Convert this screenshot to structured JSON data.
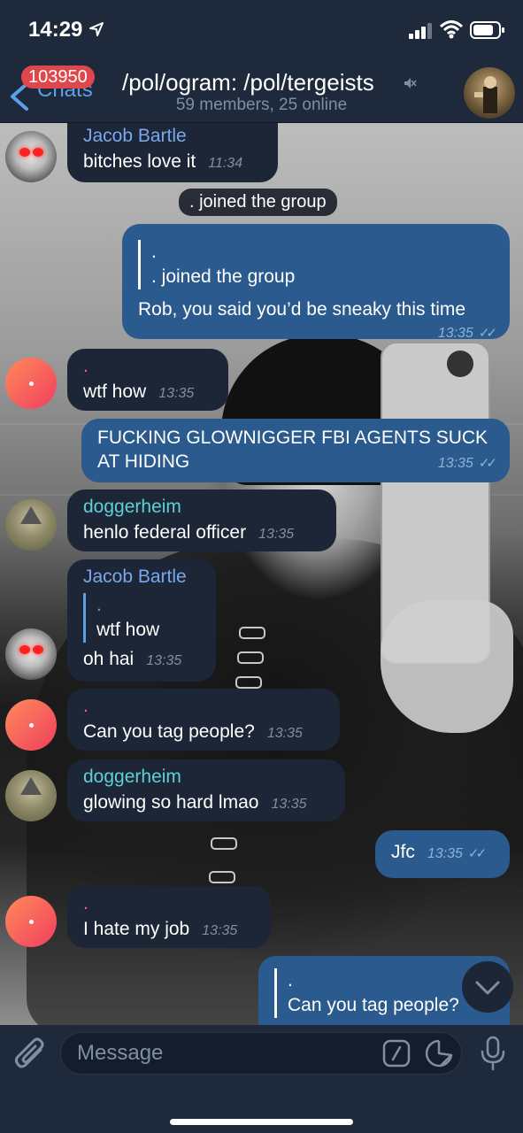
{
  "status_bar": {
    "time": "14:29"
  },
  "header": {
    "back_label": "Chats",
    "unread_count": "103950",
    "title": "/pol/ogram: /pol/tergeists",
    "subtitle": "59 members, 25 online"
  },
  "messages": {
    "m1": {
      "sender": "Jacob Bartle",
      "text": "bitches love it",
      "time": "11:34"
    },
    "s1": {
      "text": ". joined the group"
    },
    "m2": {
      "reply_name": ".",
      "reply_text": ". joined the group",
      "text": "Rob, you said you’d be sneaky this time",
      "time": "13:35"
    },
    "m3": {
      "sender": ".",
      "text": "wtf how",
      "time": "13:35"
    },
    "m4": {
      "text1": "FUCKING GLOWNIGGER FBI AGENTS SUCK",
      "text2": "AT HIDING",
      "time": "13:35"
    },
    "m5": {
      "sender": "doggerheim",
      "text": "henlo federal officer",
      "time": "13:35"
    },
    "m6": {
      "sender": "Jacob Bartle",
      "reply_name": ".",
      "reply_text": "wtf how",
      "text": "oh hai",
      "time": "13:35"
    },
    "m7": {
      "sender": ".",
      "text": "Can you tag people?",
      "time": "13:35"
    },
    "m8": {
      "sender": "doggerheim",
      "text": "glowing so hard lmao",
      "time": "13:35"
    },
    "m9": {
      "text": "Jfc",
      "time": "13:35"
    },
    "m10": {
      "sender": ".",
      "text": "I hate my job",
      "time": "13:35"
    },
    "m11": {
      "reply_name": ".",
      "reply_text": "Can you tag people?"
    }
  },
  "input": {
    "placeholder": "Message"
  },
  "colors": {
    "accent": "#5aa0e8",
    "badge": "#e0474c",
    "outgoing": "#2b5a8e",
    "incoming": "#1c2636"
  }
}
